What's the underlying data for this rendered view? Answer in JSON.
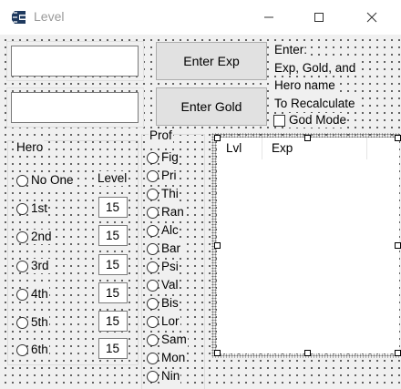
{
  "window": {
    "title": "Level"
  },
  "buttons": {
    "enter_exp": "Enter Exp",
    "enter_gold": "Enter Gold"
  },
  "info": {
    "line1": "Enter:",
    "line2": "Exp, Gold, and",
    "line3": "Hero name",
    "line4": "To Recalculate"
  },
  "god_mode": {
    "label": "God Mode",
    "checked": false
  },
  "inputs": {
    "exp_value": "",
    "gold_value": ""
  },
  "hero": {
    "group_label": "Hero",
    "level_label": "Level",
    "options": [
      "No One",
      "1st",
      "2nd",
      "3rd",
      "4th",
      "5th",
      "6th"
    ],
    "levels": [
      "15",
      "15",
      "15",
      "15",
      "15",
      "15"
    ]
  },
  "prof": {
    "group_label": "Prof",
    "options": [
      "Fig",
      "Pri",
      "Thi",
      "Ran",
      "Alc",
      "Bar",
      "Psi",
      "Val",
      "Bis",
      "Lor",
      "Sam",
      "Mon",
      "Nin"
    ]
  },
  "table": {
    "columns": [
      "Lvl",
      "Exp"
    ]
  }
}
